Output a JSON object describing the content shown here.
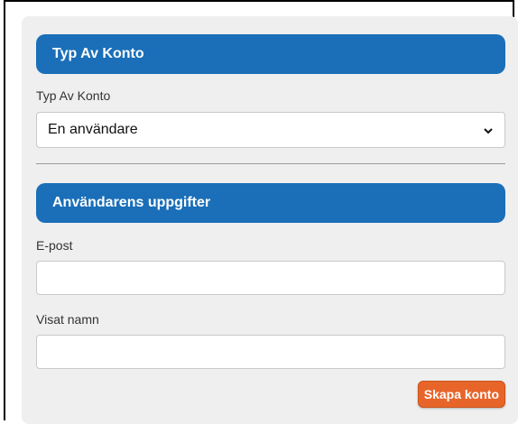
{
  "account_type_section": {
    "header": "Typ Av Konto",
    "label": "Typ Av Konto",
    "selected": "En användare"
  },
  "user_details_section": {
    "header": "Användarens uppgifter",
    "email_label": "E-post",
    "email_value": "",
    "display_name_label": "Visat namn",
    "display_name_value": ""
  },
  "submit_label": "Skapa konto",
  "colors": {
    "header_bg": "#1a6fb8",
    "button_bg": "#e8652a",
    "panel_bg": "#efefef"
  },
  "icons": {
    "select_chevron": "chevron-down-icon"
  }
}
